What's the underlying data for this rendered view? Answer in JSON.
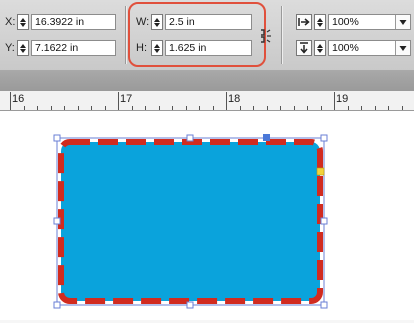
{
  "transform": {
    "x_label": "X:",
    "x_value": "16.3922 in",
    "y_label": "Y:",
    "y_value": "7.1622 in",
    "w_label": "W:",
    "w_value": "2.5 in",
    "h_label": "H:",
    "h_value": "1.625 in",
    "scale_x_value": "100%",
    "scale_y_value": "100%"
  },
  "ruler": {
    "labels": [
      "16",
      "17",
      "18",
      "19"
    ]
  },
  "selected_frame": {
    "fill_color": "#0aa3dc",
    "stroke_color": "#d12b1f",
    "stroke_style": "dashed"
  },
  "icons": {
    "constrain": "chain-link-icon",
    "scale_x": "arrow-right-icon",
    "scale_y": "arrow-down-icon"
  }
}
